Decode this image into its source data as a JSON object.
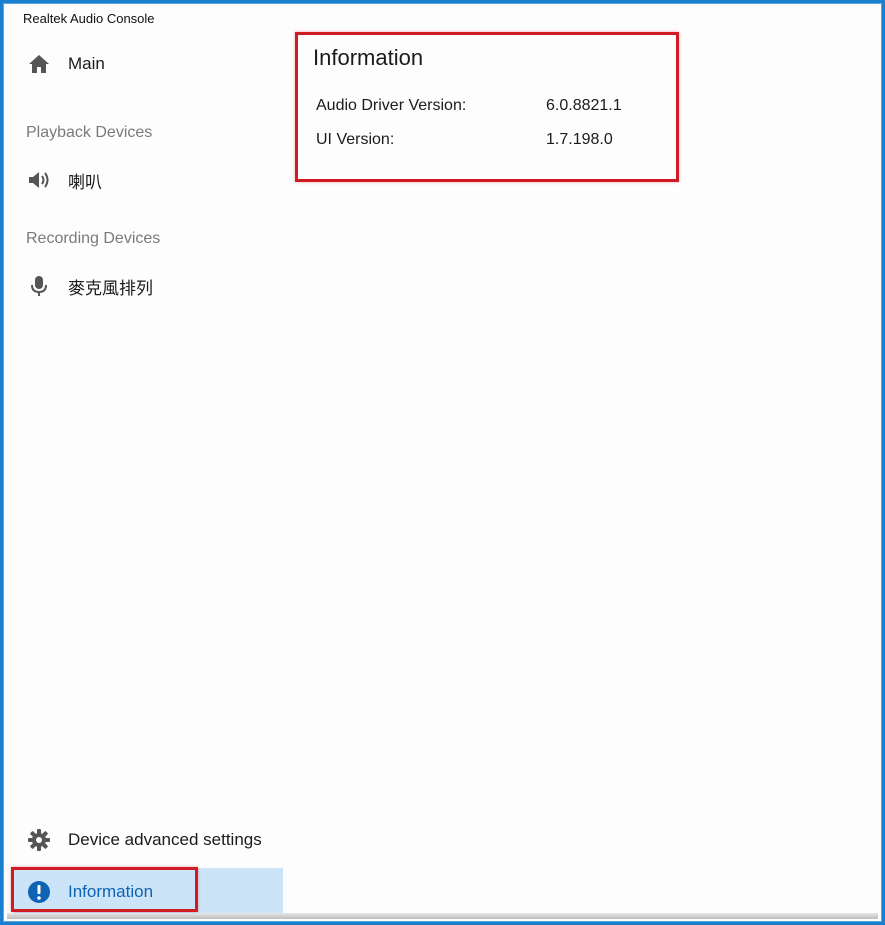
{
  "window": {
    "title": "Realtek Audio Console"
  },
  "sidebar": {
    "main_label": "Main",
    "playback_section": "Playback Devices",
    "playback_item": "喇叭",
    "recording_section": "Recording Devices",
    "recording_item": "麥克風排列",
    "advanced_label": "Device advanced settings",
    "information_label": "Information"
  },
  "information": {
    "title": "Information",
    "rows": [
      {
        "label": "Audio Driver Version:",
        "value": "6.0.8821.1"
      },
      {
        "label": "UI Version:",
        "value": "1.7.198.0"
      }
    ]
  },
  "colors": {
    "accent": "#0f63b5",
    "selected_bg": "#cce4f7",
    "highlight_red": "#d01b25",
    "frame_blue": "#1a7fcf"
  },
  "icons": {
    "main": "home-icon",
    "playback": "speaker-icon",
    "recording": "microphone-icon",
    "advanced": "gear-icon",
    "information": "info-icon"
  }
}
